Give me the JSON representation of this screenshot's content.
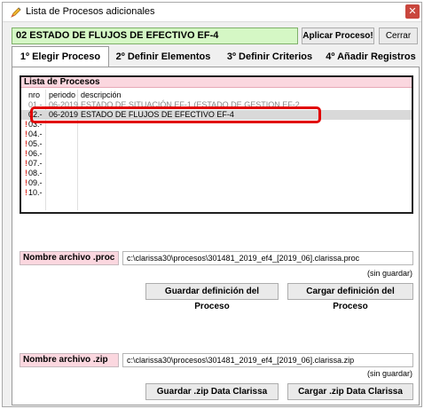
{
  "window": {
    "title": "Lista de Procesos adicionales",
    "close_glyph": "✕"
  },
  "header": {
    "process_name": "02 ESTADO DE FLUJOS DE EFECTIVO EF-4",
    "apply_label": "Aplicar Proceso!",
    "close_label": "Cerrar"
  },
  "tabs": [
    {
      "label": "1º Elegir Proceso",
      "active": true
    },
    {
      "label": "2º Definir Elementos",
      "active": false
    },
    {
      "label": "3º Definir Criterios",
      "active": false
    },
    {
      "label": "4º Añadir Registros",
      "active": false
    }
  ],
  "process_list": {
    "title": "Lista de Procesos",
    "columns": [
      "nro",
      "periodo",
      "descripción"
    ],
    "rows": [
      {
        "nro": "01.-",
        "periodo": "06-2019",
        "descripcion": "ESTADO DE SITUACIÓN EF-1 (ESTADO DE GESTION EF-2",
        "mark": "",
        "selected": false
      },
      {
        "nro": "02.-",
        "periodo": "06-2019",
        "descripcion": "ESTADO DE FLUJOS DE EFECTIVO EF-4",
        "mark": "",
        "selected": true
      },
      {
        "nro": "03.-",
        "periodo": "",
        "descripcion": "",
        "mark": "!",
        "selected": false
      },
      {
        "nro": "04.-",
        "periodo": "",
        "descripcion": "",
        "mark": "!",
        "selected": false
      },
      {
        "nro": "05.-",
        "periodo": "",
        "descripcion": "",
        "mark": "!",
        "selected": false
      },
      {
        "nro": "06.-",
        "periodo": "",
        "descripcion": "",
        "mark": "!",
        "selected": false
      },
      {
        "nro": "07.-",
        "periodo": "",
        "descripcion": "",
        "mark": "!",
        "selected": false
      },
      {
        "nro": "08.-",
        "periodo": "",
        "descripcion": "",
        "mark": "!",
        "selected": false
      },
      {
        "nro": "09.-",
        "periodo": "",
        "descripcion": "",
        "mark": "!",
        "selected": false
      },
      {
        "nro": "10.-",
        "periodo": "",
        "descripcion": "",
        "mark": "!",
        "selected": false
      }
    ]
  },
  "proc_file": {
    "label": "Nombre archivo .proc",
    "value": "c:\\clarissa30\\procesos\\301481_2019_ef4_[2019_06].clarissa.proc",
    "status": "(sin guardar)",
    "save_label": "Guardar definición del Proceso",
    "load_label": "Cargar definición del Proceso"
  },
  "zip_file": {
    "label": "Nombre archivo .zip",
    "value": "c:\\clarissa30\\procesos\\301481_2019_ef4_[2019_06].clarissa.zip",
    "status": "(sin guardar)",
    "save_label": "Guardar .zip Data Clarissa",
    "load_label": "Cargar .zip Data Clarissa"
  },
  "colors": {
    "header_green": "#d5f7c5",
    "list_header_pink": "#fbd7df",
    "highlight_red": "#e10000",
    "mark_red": "#e0342b"
  }
}
